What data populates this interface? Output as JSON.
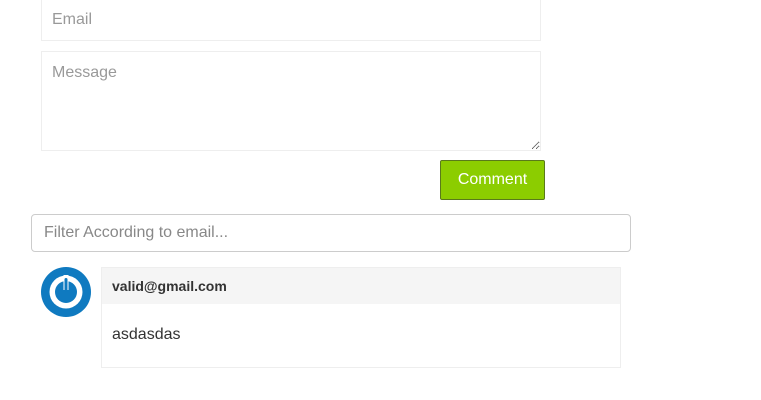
{
  "form": {
    "email_placeholder": "Email",
    "message_placeholder": "Message",
    "submit_label": "Comment",
    "submit_color": "#8ccd00"
  },
  "filter": {
    "placeholder": "Filter According to email..."
  },
  "comments": [
    {
      "author": "valid@gmail.com",
      "text": "asdasdas",
      "avatar_icon": "power-icon",
      "avatar_color": "#0f7ac0"
    }
  ]
}
